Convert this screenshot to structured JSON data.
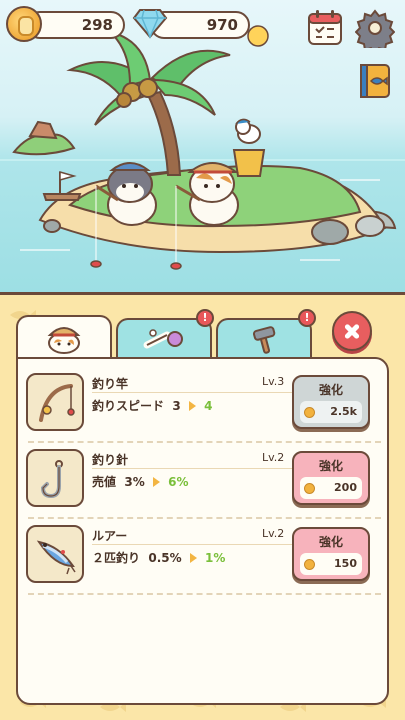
{
  "hud": {
    "coins": "298",
    "gems": "970",
    "icons": [
      "coin-icon",
      "diamond-icon",
      "calendar-icon",
      "gear-icon",
      "fish-book-icon"
    ]
  },
  "tabs": [
    {
      "name": "cat-gear",
      "icon": "cat-hat-icon",
      "active": true
    },
    {
      "name": "decor",
      "icon": "bone-flower-icon",
      "alert": "!"
    },
    {
      "name": "build",
      "icon": "hammer-icon",
      "alert": "!"
    }
  ],
  "upgrades": [
    {
      "name": "釣り竿",
      "level": "Lv.3",
      "stat": "釣りスピード",
      "current": "3",
      "next": "4",
      "button": "強化",
      "cost": "2.5k",
      "state": "disabled",
      "icon": "fishing-rod-icon"
    },
    {
      "name": "釣り針",
      "level": "Lv.2",
      "stat": "売値",
      "current": "3%",
      "next": "6%",
      "button": "強化",
      "cost": "200",
      "state": "available",
      "icon": "fish-hook-icon"
    },
    {
      "name": "ルアー",
      "level": "Lv.2",
      "stat": "２匹釣り",
      "current": "0.5%",
      "next": "1%",
      "button": "強化",
      "cost": "150",
      "state": "available",
      "icon": "lure-icon"
    }
  ],
  "colors": {
    "outline": "#6b4a3a",
    "panel": "#fbe6a8",
    "tab_inactive": "#9fe2e3",
    "upgrade_available": "#f7b3bc",
    "upgrade_disabled": "#cfd6d6",
    "alert": "#e8575a"
  }
}
